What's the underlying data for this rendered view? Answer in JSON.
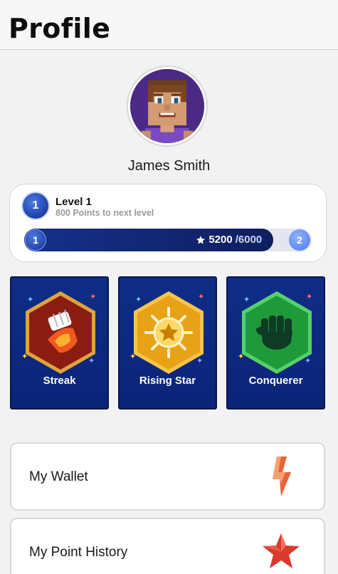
{
  "header": {
    "title": "Profile"
  },
  "user": {
    "name": "James Smith"
  },
  "level": {
    "badge_number": "1",
    "title": "Level 1",
    "subtitle": "800 Points to next level",
    "start_level": "1",
    "next_level": "2",
    "points_current": "5200",
    "points_total": "/6000",
    "progress_fraction": 0.867
  },
  "badges": [
    {
      "label": "Streak",
      "icon": "fist-punch-icon",
      "color": "#8a1c12"
    },
    {
      "label": "Rising Star",
      "icon": "star-medal-icon",
      "color": "#e8a217"
    },
    {
      "label": "Conquerer",
      "icon": "raised-fist-icon",
      "color": "#1f9a3a"
    }
  ],
  "menu": [
    {
      "label": "My Wallet",
      "icon": "lightning-bolt-icon"
    },
    {
      "label": "My Point History",
      "icon": "star-icon"
    }
  ],
  "colors": {
    "accent": "#1d3fa8",
    "badge_bg": "#0f2d86",
    "progress_fill": "#16308c"
  }
}
